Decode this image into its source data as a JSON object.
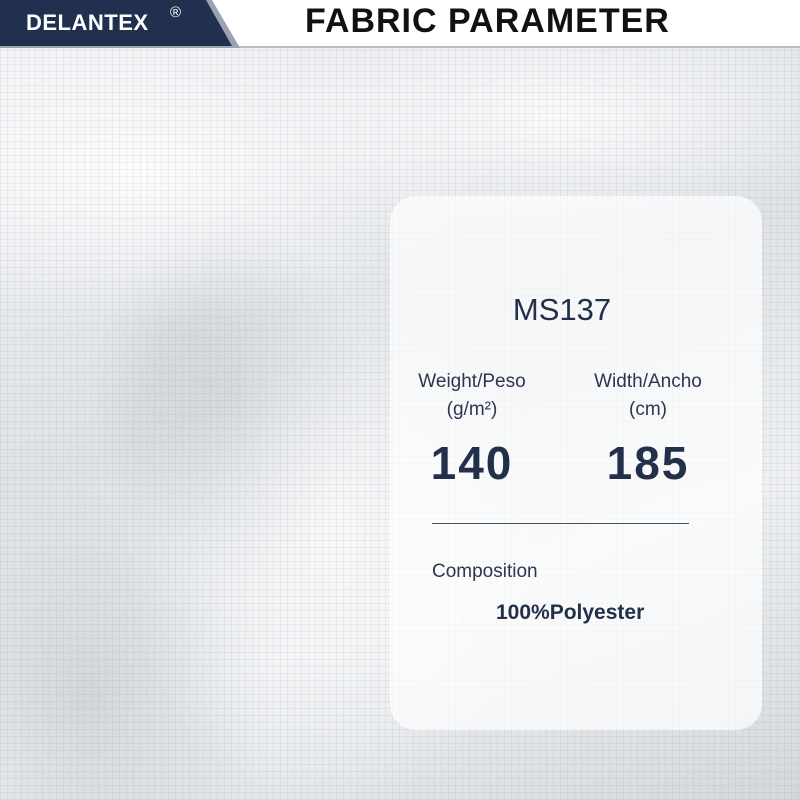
{
  "header": {
    "brand": "DELANTEX",
    "brand_mark": "®",
    "title": "FABRIC PARAMETER"
  },
  "card": {
    "code": "MS137",
    "weight": {
      "label": "Weight/Peso",
      "unit": "(g/m²)",
      "value": "140"
    },
    "width": {
      "label": "Width/Ancho",
      "unit": "(cm)",
      "value": "185"
    },
    "composition": {
      "label": "Composition",
      "value": "100%Polyester"
    }
  },
  "colors": {
    "brand_navy": "#22304f",
    "text_navy": "#23304c"
  }
}
